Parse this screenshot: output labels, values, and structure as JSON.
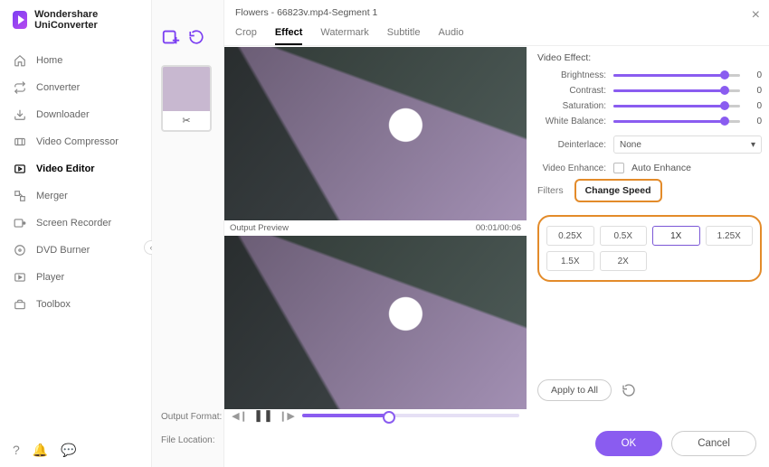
{
  "brand": {
    "name": "Wondershare UniConverter"
  },
  "sidebar": {
    "items": [
      {
        "label": "Home",
        "icon": "home"
      },
      {
        "label": "Converter",
        "icon": "convert"
      },
      {
        "label": "Downloader",
        "icon": "download"
      },
      {
        "label": "Video Compressor",
        "icon": "compress"
      },
      {
        "label": "Video Editor",
        "icon": "editor",
        "active": true
      },
      {
        "label": "Merger",
        "icon": "merge"
      },
      {
        "label": "Screen Recorder",
        "icon": "record"
      },
      {
        "label": "DVD Burner",
        "icon": "dvd"
      },
      {
        "label": "Player",
        "icon": "play"
      },
      {
        "label": "Toolbox",
        "icon": "toolbox"
      }
    ]
  },
  "mid": {
    "output_format_label": "Output Format:",
    "file_location_label": "File Location:"
  },
  "editor": {
    "title": "Flowers - 66823v.mp4-Segment 1",
    "tabs": [
      "Crop",
      "Effect",
      "Watermark",
      "Subtitle",
      "Audio"
    ],
    "active_tab": "Effect",
    "output_preview_label": "Output Preview",
    "time": "00:01/00:06",
    "video_effect_label": "Video Effect:",
    "sliders": [
      {
        "label": "Brightness:",
        "value": "0"
      },
      {
        "label": "Contrast:",
        "value": "0"
      },
      {
        "label": "Saturation:",
        "value": "0"
      },
      {
        "label": "White Balance:",
        "value": "0"
      }
    ],
    "deinterlace_label": "Deinterlace:",
    "deinterlace_value": "None",
    "enhance_label": "Video Enhance:",
    "enhance_checkbox": "Auto Enhance",
    "subtabs": [
      "Filters",
      "Change Speed"
    ],
    "active_subtab": "Change Speed",
    "speeds": [
      "0.25X",
      "0.5X",
      "1X",
      "1.25X",
      "1.5X",
      "2X"
    ],
    "selected_speed": "1X",
    "apply_all": "Apply to All",
    "ok": "OK",
    "cancel": "Cancel"
  }
}
